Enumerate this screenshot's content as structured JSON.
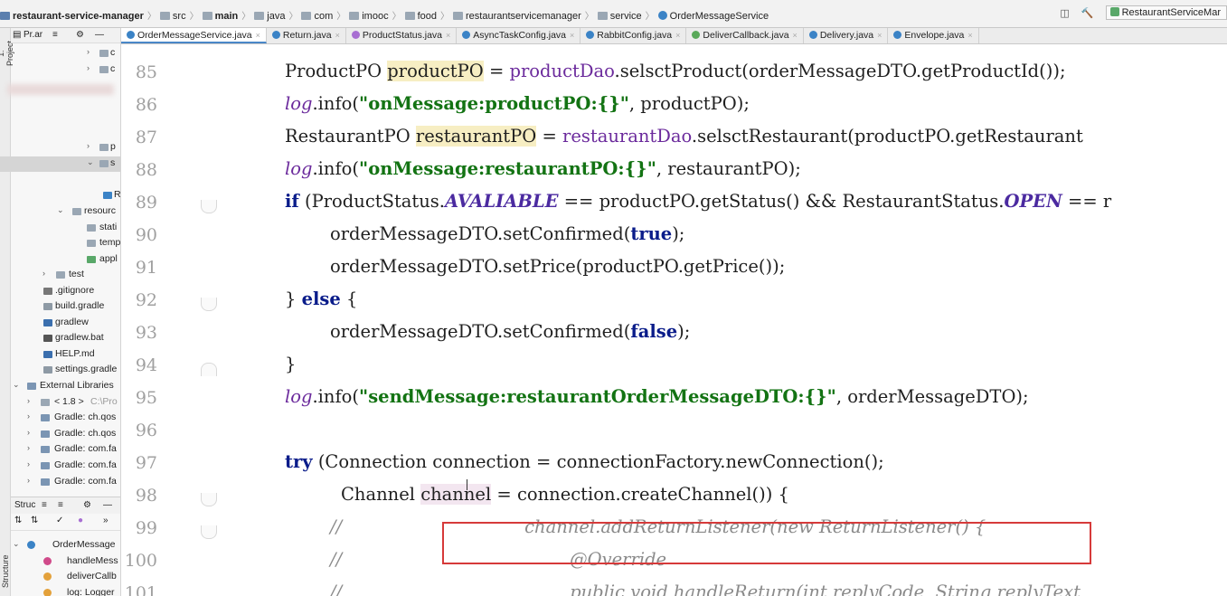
{
  "breadcrumb": {
    "items": [
      {
        "label": "restaurant-service-manager",
        "bold": true,
        "icon": "module-icon"
      },
      {
        "label": "src",
        "bold": false,
        "icon": "folder-icon"
      },
      {
        "label": "main",
        "bold": true,
        "icon": "folder-icon"
      },
      {
        "label": "java",
        "bold": false,
        "icon": "folder-icon"
      },
      {
        "label": "com",
        "bold": false,
        "icon": "package-icon"
      },
      {
        "label": "imooc",
        "bold": false,
        "icon": "package-icon"
      },
      {
        "label": "food",
        "bold": false,
        "icon": "package-icon"
      },
      {
        "label": "restaurantservicemanager",
        "bold": false,
        "icon": "package-icon"
      },
      {
        "label": "service",
        "bold": false,
        "icon": "package-icon"
      },
      {
        "label": "OrderMessageService",
        "bold": false,
        "icon": "class-icon"
      }
    ],
    "run_config": "RestaurantServiceMar"
  },
  "project_panel": {
    "header": "Pr.ar",
    "side_label_top": "1: Project",
    "side_label_bottom": "Structure",
    "tree": [
      {
        "label": "c",
        "arrow": "›"
      },
      {
        "label": "c",
        "arrow": "›"
      },
      {
        "label": "p",
        "arrow": "›"
      },
      {
        "label": "s",
        "arrow": "⌄"
      },
      {
        "label": "R",
        "arrow": ""
      },
      {
        "label": "resourc",
        "arrow": "⌄"
      },
      {
        "label": "stati",
        "arrow": ""
      },
      {
        "label": "temp",
        "arrow": ""
      },
      {
        "label": "appl",
        "arrow": ""
      },
      {
        "label": "test",
        "arrow": "›"
      },
      {
        "label": ".gitignore",
        "arrow": ""
      },
      {
        "label": "build.gradle",
        "arrow": ""
      },
      {
        "label": "gradlew",
        "arrow": ""
      },
      {
        "label": "gradlew.bat",
        "arrow": ""
      },
      {
        "label": "HELP.md",
        "arrow": ""
      },
      {
        "label": "settings.gradle",
        "arrow": ""
      },
      {
        "label": "External Libraries",
        "arrow": "⌄"
      },
      {
        "label": "< 1.8 >",
        "sub": "C:\\Pro",
        "arrow": "›"
      },
      {
        "label": "Gradle: ch.qos",
        "arrow": "›"
      },
      {
        "label": "Gradle: ch.qos",
        "arrow": "›"
      },
      {
        "label": "Gradle: com.fa",
        "arrow": "›"
      },
      {
        "label": "Gradle: com.fa",
        "arrow": "›"
      },
      {
        "label": "Gradle: com.fa",
        "arrow": "›"
      }
    ],
    "structure": {
      "header": "Struc",
      "items": [
        {
          "label": "OrderMessage",
          "arrow": "⌄"
        },
        {
          "label": "handleMess",
          "arrow": ""
        },
        {
          "label": "deliverCallb",
          "arrow": ""
        },
        {
          "label": "log: Logger",
          "arrow": ""
        }
      ]
    }
  },
  "tabs": [
    {
      "label": "OrderMessageService.java",
      "kind": "class",
      "active": true
    },
    {
      "label": "Return.java",
      "kind": "class",
      "active": false
    },
    {
      "label": "ProductStatus.java",
      "kind": "enum",
      "active": false
    },
    {
      "label": "AsyncTaskConfig.java",
      "kind": "class",
      "active": false
    },
    {
      "label": "RabbitConfig.java",
      "kind": "class",
      "active": false
    },
    {
      "label": "DeliverCallback.java",
      "kind": "iface",
      "active": false
    },
    {
      "label": "Delivery.java",
      "kind": "class",
      "active": false
    },
    {
      "label": "Envelope.java",
      "kind": "class",
      "active": false
    }
  ],
  "editor": {
    "line_numbers": [
      "85",
      "86",
      "87",
      "88",
      "89",
      "90",
      "91",
      "92",
      "93",
      "94",
      "95",
      "96",
      "97",
      "98",
      "99",
      "100",
      "101"
    ],
    "lines": {
      "l85": {
        "t1": "ProductPO ",
        "v1": "productPO",
        "t2": " = ",
        "f1": "productDao",
        "t3": ".selsctProduct(orderMessageDTO.getProductId());"
      },
      "l86": {
        "f1": "log",
        "t1": ".info(",
        "s1": "\"onMessage:productPO:{}\"",
        "t2": ", productPO);"
      },
      "l87": {
        "t1": "RestaurantPO ",
        "v1": "restaurantPO",
        "t2": " = ",
        "f1": "restaurantDao",
        "t3": ".selsctRestaurant(productPO.getRestaurant"
      },
      "l88": {
        "f1": "log",
        "t1": ".info(",
        "s1": "\"onMessage:restaurantPO:{}\"",
        "t2": ", restaurantPO);"
      },
      "l89": {
        "k1": "if",
        "t1": " (ProductStatus.",
        "c1": "AVALIABLE",
        "t2": " == productPO.getStatus() && RestaurantStatus.",
        "c2": "OPEN",
        "t3": " == r"
      },
      "l90": {
        "t1": "orderMessageDTO.setConfirmed(",
        "k1": "true",
        "t2": ");"
      },
      "l91": {
        "t1": "orderMessageDTO.setPrice(productPO.getPrice());"
      },
      "l92": {
        "t1": "} ",
        "k1": "else",
        "t2": " {"
      },
      "l93": {
        "t1": "orderMessageDTO.setConfirmed(",
        "k1": "false",
        "t2": ");"
      },
      "l94": {
        "t1": "}"
      },
      "l95": {
        "f1": "log",
        "t1": ".info(",
        "s1": "\"sendMessage:restaurantOrderMessageDTO:{}\"",
        "t2": ", orderMessageDTO);"
      },
      "l97": {
        "k1": "try",
        "t1": " (Connection connection = connectionFactory.newConnection();"
      },
      "l98": {
        "t1": "Channel ",
        "v1": "channel",
        "t2": " = connection.createChannel()) {"
      },
      "l99": {
        "c1": "//",
        "c2": "channel.addReturnListener(new ReturnListener() {"
      },
      "l100": {
        "c1": "//",
        "c2": "@Override"
      },
      "l101": {
        "c1": "//",
        "c2": "public void handleReturn(int replyCode, String replyText"
      }
    }
  },
  "colors": {
    "keyword": "#0a1c8a",
    "field": "#6b2a9c",
    "string": "#137313",
    "highlight_box": "#d63a3a",
    "line_number": "#a0a0a0"
  }
}
